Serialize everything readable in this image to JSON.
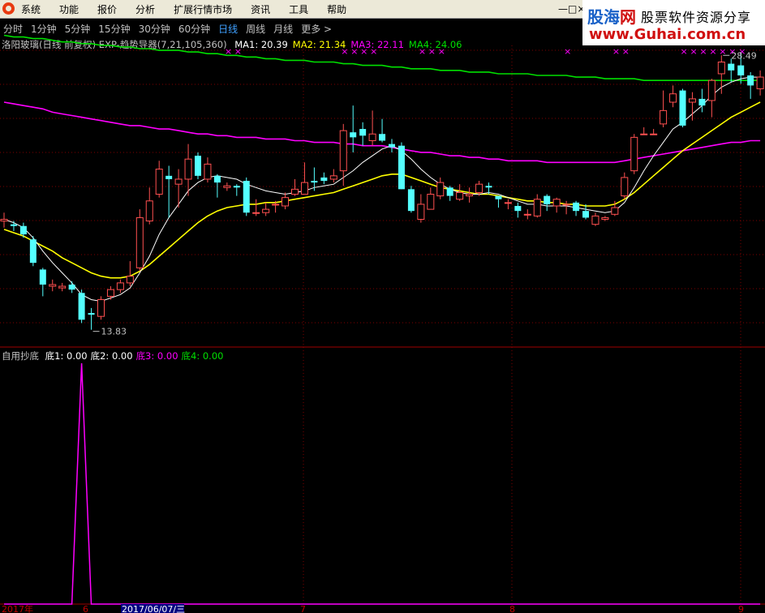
{
  "menu": {
    "items": [
      "系统",
      "功能",
      "报价",
      "分析",
      "扩展行情市场",
      "资讯",
      "工具",
      "帮助"
    ],
    "window_controls": "—□×"
  },
  "banner": {
    "brand_blue": "股海",
    "brand_red": "网",
    "tagline": "股票软件资源分享",
    "url": "www.Guhai.com.cn"
  },
  "periods": {
    "items": [
      "分时",
      "1分钟",
      "5分钟",
      "15分钟",
      "30分钟",
      "60分钟",
      "日线",
      "周线",
      "月线",
      "更多 >"
    ],
    "active_index": 6
  },
  "main_indicator": {
    "stock": "洛阳玻璃(日线 前复权)",
    "indicator": "EXP-趋势导器(7,21,105,360)",
    "ma": [
      {
        "label": "MA1: 20.39",
        "color": "#ffffff"
      },
      {
        "label": "MA2: 21.34",
        "color": "#ffff00"
      },
      {
        "label": "MA3: 22.11",
        "color": "#ff00ff"
      },
      {
        "label": "MA4: 24.06",
        "color": "#00e000"
      }
    ],
    "high_label": "28.49",
    "low_label": "13.83"
  },
  "sub_indicator": {
    "name": "自用抄底",
    "values": [
      {
        "label": "底1: 0.00",
        "color": "#ffffff"
      },
      {
        "label": "底2: 0.00",
        "color": "#ffffff"
      },
      {
        "label": "底3: 0.00",
        "color": "#ff00ff"
      },
      {
        "label": "底4: 0.00",
        "color": "#00e000"
      }
    ]
  },
  "bottom_axis": {
    "labels": [
      {
        "text": "2017年",
        "style": "plain"
      },
      {
        "text": "6",
        "style": "plain"
      },
      {
        "text": "2017/06/07/三",
        "style": "highlight"
      },
      {
        "text": "7",
        "style": "plain"
      },
      {
        "text": "8",
        "style": "plain"
      },
      {
        "text": "9",
        "style": "plain"
      }
    ]
  },
  "colors": {
    "up": "#ff5050",
    "down": "#54ffff",
    "ma1": "#ffffff",
    "ma2": "#ffff00",
    "ma3": "#ff00ff",
    "ma4": "#00e000",
    "grid": "#800000",
    "signal": "#ff00ff"
  },
  "chart_data": {
    "type": "candlestick",
    "ylim": [
      13.3,
      30.6
    ],
    "candles": [
      [
        20.3,
        20.4,
        20.8,
        19.9
      ],
      [
        20.1,
        20.0,
        20.3,
        19.7
      ],
      [
        20.0,
        19.5,
        20.2,
        19.3
      ],
      [
        19.2,
        17.8,
        19.4,
        17.6
      ],
      [
        17.4,
        16.5,
        17.5,
        15.8
      ],
      [
        16.4,
        16.5,
        16.8,
        16.1
      ],
      [
        16.3,
        16.4,
        16.6,
        16.1
      ],
      [
        16.5,
        16.2,
        16.7,
        16.0
      ],
      [
        16.0,
        14.4,
        16.2,
        14.2
      ],
      [
        14.8,
        14.7,
        15.1,
        13.8
      ],
      [
        14.6,
        15.6,
        15.8,
        14.4
      ],
      [
        15.8,
        16.2,
        16.4,
        15.6
      ],
      [
        16.2,
        16.6,
        16.8,
        16.0
      ],
      [
        16.6,
        17.0,
        17.9,
        16.4
      ],
      [
        17.5,
        20.5,
        21.0,
        17.3
      ],
      [
        20.3,
        21.5,
        22.3,
        20.1
      ],
      [
        21.9,
        23.4,
        23.9,
        21.7
      ],
      [
        23.0,
        22.8,
        23.6,
        20.5
      ],
      [
        22.5,
        22.8,
        23.4,
        21.1
      ],
      [
        22.8,
        24.0,
        24.9,
        21.8
      ],
      [
        24.2,
        23.0,
        24.4,
        22.8
      ],
      [
        22.8,
        23.7,
        24.1,
        22.6
      ],
      [
        23.0,
        22.6,
        23.1,
        21.7
      ],
      [
        22.3,
        22.4,
        22.6,
        22.1
      ],
      [
        22.4,
        22.3,
        22.5,
        21.8
      ],
      [
        22.7,
        20.8,
        22.9,
        20.6
      ],
      [
        20.8,
        20.8,
        21.6,
        20.6
      ],
      [
        20.8,
        21.0,
        21.4,
        20.6
      ],
      [
        21.3,
        21.3,
        21.5,
        20.8
      ],
      [
        21.2,
        21.7,
        22.0,
        21.0
      ],
      [
        21.9,
        22.2,
        22.8,
        21.8
      ],
      [
        21.9,
        22.6,
        23.8,
        21.9
      ],
      [
        22.7,
        22.6,
        23.5,
        22.1
      ],
      [
        22.9,
        22.7,
        23.2,
        22.5
      ],
      [
        22.8,
        23.0,
        23.4,
        22.6
      ],
      [
        23.3,
        25.7,
        26.1,
        22.4
      ],
      [
        25.6,
        25.3,
        27.2,
        24.4
      ],
      [
        25.8,
        25.4,
        26.2,
        24.8
      ],
      [
        25.1,
        25.5,
        26.9,
        24.8
      ],
      [
        25.5,
        25.1,
        26.4,
        25.0
      ],
      [
        24.9,
        24.7,
        25.2,
        24.4
      ],
      [
        24.8,
        22.2,
        25.0,
        22.2
      ],
      [
        22.2,
        20.9,
        22.4,
        20.8
      ],
      [
        20.4,
        21.3,
        21.9,
        20.2
      ],
      [
        21.0,
        21.9,
        22.3,
        21.0
      ],
      [
        21.8,
        22.6,
        22.9,
        21.6
      ],
      [
        22.3,
        21.8,
        22.4,
        21.5
      ],
      [
        21.6,
        22.0,
        22.5,
        21.5
      ],
      [
        21.8,
        21.9,
        22.3,
        21.4
      ],
      [
        22.0,
        22.5,
        22.7,
        21.8
      ],
      [
        22.4,
        22.3,
        22.6,
        21.9
      ],
      [
        21.8,
        21.6,
        21.8,
        21.1
      ],
      [
        21.4,
        21.4,
        21.6,
        21.0
      ],
      [
        21.2,
        20.9,
        21.4,
        20.5
      ],
      [
        20.7,
        20.7,
        21.0,
        20.4
      ],
      [
        20.6,
        21.6,
        21.9,
        20.5
      ],
      [
        21.8,
        21.3,
        21.9,
        20.9
      ],
      [
        21.2,
        21.6,
        21.7,
        20.8
      ],
      [
        21.3,
        21.3,
        21.5,
        20.7
      ],
      [
        21.4,
        20.9,
        21.5,
        20.6
      ],
      [
        20.9,
        20.5,
        21.3,
        20.4
      ],
      [
        20.1,
        20.6,
        20.8,
        20.0
      ],
      [
        20.4,
        20.5,
        20.6,
        20.3
      ],
      [
        20.7,
        21.1,
        21.5,
        20.6
      ],
      [
        21.8,
        22.9,
        23.2,
        21.6
      ],
      [
        23.3,
        25.3,
        25.5,
        23.1
      ],
      [
        25.5,
        25.5,
        25.9,
        25.5
      ],
      [
        25.5,
        25.5,
        25.8,
        25.5
      ],
      [
        26.1,
        26.9,
        28.1,
        25.9
      ],
      [
        27.4,
        27.9,
        28.4,
        27.1
      ],
      [
        28.1,
        26.0,
        28.2,
        25.9
      ],
      [
        27.4,
        27.6,
        28.0,
        26.3
      ],
      [
        27.6,
        27.2,
        28.2,
        26.8
      ],
      [
        27.5,
        28.7,
        28.8,
        26.5
      ],
      [
        29.1,
        29.8,
        30.2,
        27.9
      ],
      [
        29.7,
        29.3,
        30.0,
        28.6
      ],
      [
        29.6,
        29.0,
        30.4,
        28.5
      ],
      [
        29.0,
        28.4,
        29.2,
        27.6
      ],
      [
        28.2,
        28.9,
        29.3,
        27.8
      ]
    ],
    "ma1": [
      20.4,
      20.2,
      19.9,
      19.3,
      18.5,
      17.8,
      17.2,
      16.6,
      15.9,
      15.6,
      15.5,
      15.7,
      15.9,
      16.3,
      17.2,
      18.2,
      19.5,
      20.5,
      21.3,
      22.1,
      22.6,
      22.9,
      23.0,
      22.9,
      22.8,
      22.5,
      22.3,
      22.1,
      22.0,
      21.9,
      22.0,
      22.1,
      22.3,
      22.4,
      22.5,
      22.9,
      23.3,
      23.8,
      24.2,
      24.6,
      24.8,
      24.5,
      24.0,
      23.4,
      22.9,
      22.5,
      22.2,
      22.0,
      21.9,
      21.9,
      22.0,
      21.9,
      21.7,
      21.5,
      21.3,
      21.3,
      21.2,
      21.2,
      21.2,
      21.1,
      21.0,
      20.9,
      20.8,
      20.9,
      21.4,
      22.3,
      23.3,
      24.2,
      25.0,
      25.8,
      26.2,
      26.7,
      27.2,
      27.8,
      28.3,
      28.6,
      28.8,
      28.9,
      28.9
    ],
    "ma2": [
      19.8,
      19.6,
      19.4,
      19.1,
      18.8,
      18.5,
      18.1,
      17.8,
      17.5,
      17.2,
      17.0,
      16.9,
      16.9,
      17.0,
      17.3,
      17.7,
      18.2,
      18.7,
      19.2,
      19.7,
      20.2,
      20.6,
      20.9,
      21.1,
      21.2,
      21.3,
      21.3,
      21.4,
      21.4,
      21.5,
      21.6,
      21.7,
      21.8,
      21.9,
      22.0,
      22.2,
      22.4,
      22.6,
      22.8,
      23.0,
      23.1,
      23.1,
      22.9,
      22.7,
      22.5,
      22.3,
      22.2,
      22.1,
      22.0,
      21.9,
      21.9,
      21.8,
      21.7,
      21.6,
      21.5,
      21.5,
      21.4,
      21.4,
      21.3,
      21.3,
      21.2,
      21.2,
      21.2,
      21.3,
      21.6,
      22.0,
      22.5,
      23.0,
      23.5,
      24.0,
      24.5,
      24.9,
      25.3,
      25.7,
      26.1,
      26.5,
      26.8,
      27.1,
      27.4
    ],
    "ma3": [
      27.4,
      27.3,
      27.2,
      27.1,
      27.0,
      26.8,
      26.7,
      26.6,
      26.5,
      26.4,
      26.3,
      26.2,
      26.1,
      26.0,
      26.0,
      25.9,
      25.8,
      25.8,
      25.7,
      25.6,
      25.5,
      25.5,
      25.4,
      25.4,
      25.3,
      25.3,
      25.3,
      25.2,
      25.2,
      25.2,
      25.1,
      25.1,
      25.0,
      25.0,
      25.0,
      24.9,
      24.9,
      24.8,
      24.8,
      24.8,
      24.7,
      24.6,
      24.5,
      24.4,
      24.4,
      24.3,
      24.2,
      24.2,
      24.1,
      24.1,
      24.0,
      24.0,
      23.9,
      23.9,
      23.9,
      23.9,
      23.8,
      23.8,
      23.8,
      23.8,
      23.8,
      23.8,
      23.8,
      23.8,
      23.9,
      24.0,
      24.1,
      24.2,
      24.3,
      24.4,
      24.5,
      24.6,
      24.7,
      24.8,
      24.9,
      25.0,
      25.0,
      25.1,
      25.1
    ],
    "ma4": [
      31.4,
      31.3,
      31.3,
      31.2,
      31.2,
      31.1,
      31.0,
      31.0,
      30.9,
      30.9,
      30.8,
      30.8,
      30.7,
      30.7,
      30.6,
      30.6,
      30.5,
      30.5,
      30.5,
      30.4,
      30.4,
      30.3,
      30.3,
      30.2,
      30.2,
      30.1,
      30.1,
      30.0,
      30.0,
      29.9,
      29.9,
      29.9,
      29.8,
      29.8,
      29.8,
      29.7,
      29.7,
      29.6,
      29.6,
      29.6,
      29.5,
      29.5,
      29.4,
      29.4,
      29.4,
      29.3,
      29.3,
      29.3,
      29.2,
      29.2,
      29.2,
      29.1,
      29.1,
      29.1,
      29.1,
      29.0,
      29.0,
      29.0,
      29.0,
      28.9,
      28.9,
      28.9,
      28.8,
      28.8,
      28.8,
      28.8,
      28.7,
      28.7,
      28.7,
      28.7,
      28.7,
      28.7,
      28.7,
      28.7,
      28.7,
      28.7,
      28.7,
      28.7,
      28.7
    ],
    "signals_index": [
      23,
      24,
      35,
      36,
      37,
      38,
      43,
      44,
      45,
      58,
      63,
      64,
      70,
      71,
      72,
      73,
      74,
      75,
      76
    ],
    "sub_values": [
      0,
      0,
      0,
      0,
      0,
      0,
      0,
      0,
      100,
      0,
      0,
      0,
      0,
      0,
      0,
      0,
      0,
      0,
      0,
      0,
      0,
      0,
      0,
      0,
      0,
      0,
      0,
      0,
      0,
      0,
      0,
      0,
      0,
      0,
      0,
      0,
      0,
      0,
      0,
      0,
      0,
      0,
      0,
      0,
      0,
      0,
      0,
      0,
      0,
      0,
      0,
      0,
      0,
      0,
      0,
      0,
      0,
      0,
      0,
      0,
      0,
      0,
      0,
      0,
      0,
      0,
      0,
      0,
      0,
      0,
      0,
      0,
      0,
      0,
      0,
      0,
      0,
      0,
      0
    ]
  }
}
